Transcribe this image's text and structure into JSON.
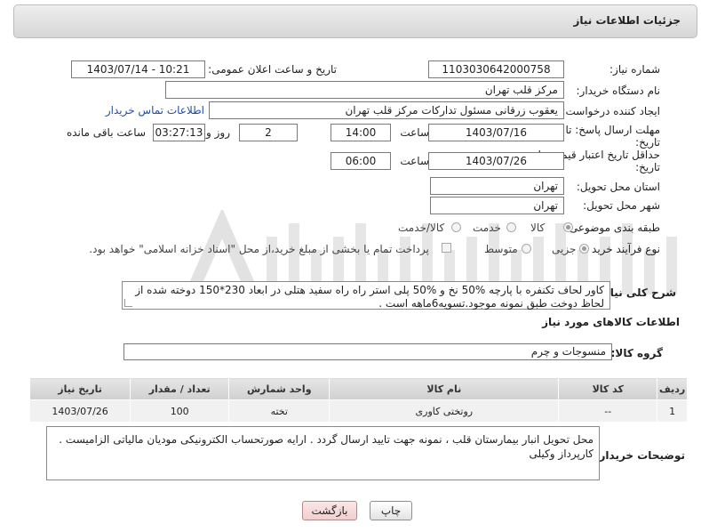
{
  "header": {
    "title": "جزئیات اطلاعات نیاز"
  },
  "need_number": {
    "label": "شماره نیاز:",
    "value": "1103030642000758"
  },
  "announce_datetime": {
    "label": "تاریخ و ساعت اعلان عمومی:",
    "value": "1403/07/14 - 10:21"
  },
  "buyer_org": {
    "label": "نام دستگاه خریدار:",
    "value": "مرکز قلب تهران"
  },
  "requester": {
    "label": "ایجاد کننده درخواست:",
    "value": "یعقوب زرقانی مسئول تداركات مرکز قلب تهران",
    "contact_link": "اطلاعات تماس خریدار"
  },
  "reply_deadline": {
    "label_line1": "مهلت ارسال پاسخ: تا",
    "label_line2": "تاریخ:",
    "date": "1403/07/16",
    "time_label": "ساعت",
    "time": "14:00",
    "days": "2",
    "days_label": "روز و",
    "remaining": "03:27:13",
    "remaining_label": "ساعت باقی مانده"
  },
  "price_validity": {
    "label_line1": "حداقل تاریخ اعتبار قیمت: تا",
    "label_line2": "تاریخ:",
    "date": "1403/07/26",
    "time_label": "ساعت",
    "time": "06:00"
  },
  "delivery_province": {
    "label": "استان محل تحویل:",
    "value": "تهران"
  },
  "delivery_city": {
    "label": "شهر محل تحویل:",
    "value": "تهران"
  },
  "category": {
    "label": "طبقه بندی موضوعی:",
    "options": [
      "کالا",
      "خدمت",
      "کالا/خدمت"
    ],
    "selected": "کالا"
  },
  "purchase_process": {
    "label": "نوع فرآیند خرید :",
    "options": [
      "جزیی",
      "متوسط"
    ],
    "selected": "جزیی",
    "payment_note": "پرداخت تمام یا بخشی از مبلغ خرید،از محل \"اسناد خزانه اسلامی\" خواهد بود."
  },
  "description": {
    "label": "شرح کلی نیاز:",
    "value": "کاور لحاف تکنفره با پارچه %50 نخ و %50 پلی استر راه راه سفید هتلی در ابعاد 230*150 دوخته شده از لحاظ دوخت طبق نمونه موجود.تسویه6ماهه است ."
  },
  "goods_section": {
    "title": "اطلاعات کالاهای مورد نیاز"
  },
  "goods_group": {
    "label": "گروه کالا:",
    "value": "منسوجات و چرم"
  },
  "items_table": {
    "headers": [
      "ردیف",
      "کد کالا",
      "نام کالا",
      "واحد شمارش",
      "تعداد / مقدار",
      "تاریخ نیاز"
    ],
    "rows": [
      [
        "1",
        "--",
        "روتختی کاوری",
        "تخته",
        "100",
        "1403/07/26"
      ]
    ]
  },
  "buyer_notes": {
    "label": "توضیحات خریدار:",
    "value": "محل تحویل انبار بیمارستان قلب ، نمونه جهت تایید ارسال گردد . ارایه صورتحساب الکترونیکی مودیان مالیاتی الزامیست . کارپرداز وکیلی"
  },
  "buttons": {
    "print": "چاپ",
    "back": "بازگشت"
  },
  "colors": {
    "back_button": "#f7d9d9",
    "link": "#1f4fa8",
    "header_bg": "#dcdcdc"
  }
}
